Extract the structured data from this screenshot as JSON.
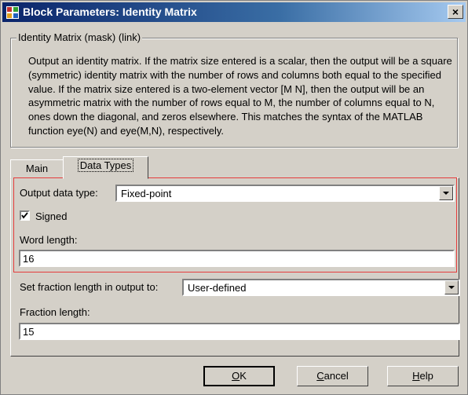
{
  "window": {
    "title": "Block Parameters: Identity Matrix",
    "close_glyph": "×"
  },
  "group": {
    "legend": "Identity Matrix (mask) (link)",
    "description": "Output an identity matrix.  If the matrix size entered is a scalar, then the output will be a square (symmetric) identity matrix with the number of rows and columns both equal to the specified value.  If the matrix size entered is a two-element vector [M N], then the output will be an asymmetric matrix with the number of rows equal to M, the number of columns equal to N, ones down the diagonal, and zeros elsewhere.  This matches the syntax of the MATLAB function eye(N) and eye(M,N), respectively."
  },
  "tabs": [
    {
      "label": "Main",
      "selected": false
    },
    {
      "label": "Data Types",
      "selected": true
    }
  ],
  "form": {
    "output_data_type_label": "Output data type:",
    "output_data_type_value": "Fixed-point",
    "signed_label": "Signed",
    "signed_checked": true,
    "word_length_label": "Word length:",
    "word_length_value": "16",
    "fraction_mode_label": "Set fraction length in output to:",
    "fraction_mode_value": "User-defined",
    "fraction_length_label": "Fraction length:",
    "fraction_length_value": "15"
  },
  "buttons": {
    "ok_hotkey": "O",
    "ok_rest": "K",
    "cancel_hotkey": "C",
    "cancel_rest": "ancel",
    "help_hotkey": "H",
    "help_rest": "elp"
  },
  "colors": {
    "highlight_border": "#e53c3c",
    "titlebar_start": "#0a246a",
    "titlebar_end": "#a6caf0"
  }
}
